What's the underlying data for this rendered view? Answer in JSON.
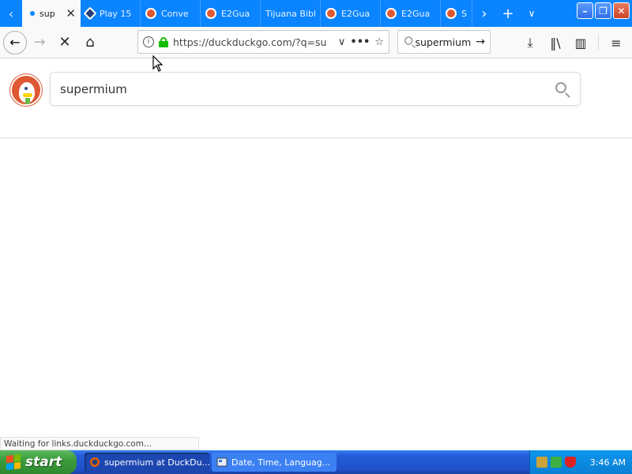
{
  "browser": {
    "tabs": [
      {
        "label": "sup",
        "active": true,
        "icon": "loading-dot-icon"
      },
      {
        "label": "Play 15",
        "active": false,
        "icon": "play-icon"
      },
      {
        "label": "Conve",
        "active": false,
        "icon": "duckduckgo-icon"
      },
      {
        "label": "E2Gua",
        "active": false,
        "icon": "duckduckgo-icon"
      },
      {
        "label": "Tijuana Bibl",
        "active": false,
        "icon": "none"
      },
      {
        "label": "E2Gua",
        "active": false,
        "icon": "duckduckgo-icon"
      },
      {
        "label": "E2Gua",
        "active": false,
        "icon": "duckduckgo-icon"
      },
      {
        "label": "Sp",
        "active": false,
        "icon": "duckduckgo-icon"
      }
    ],
    "url": "https://duckduckgo.com/?q=su",
    "search_value": "supermium",
    "status_text": "Waiting for links.duckduckgo.com..."
  },
  "page": {
    "query": "supermium"
  },
  "taskbar": {
    "start_label": "start",
    "tasks": [
      {
        "label": "supermium at DuckDu...",
        "active": true
      },
      {
        "label": "Date, Time, Languag...",
        "active": false
      }
    ],
    "clock": "3:46 AM"
  },
  "colors": {
    "tabbar": "#0a84ff",
    "ddg_orange": "#de5833",
    "lock_green": "#12bc00",
    "taskbar_blue": "#245edb",
    "start_green": "#3c9c3c"
  }
}
